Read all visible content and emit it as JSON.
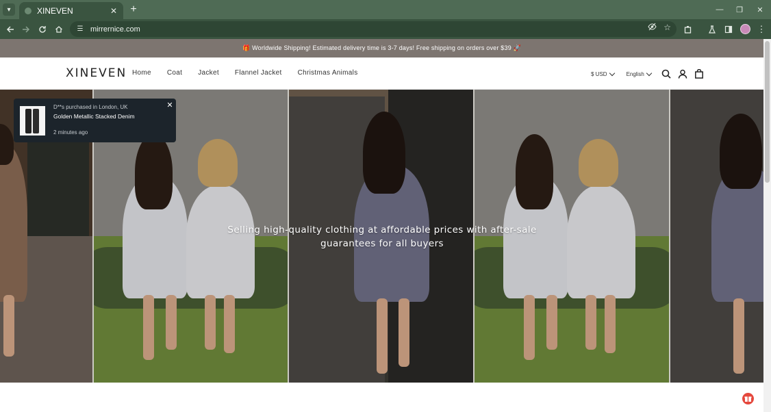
{
  "browser": {
    "tab_title": "XINEVEN",
    "tab_close": "✕",
    "new_tab": "+",
    "url": "mirrernice.com",
    "window_minimize": "—",
    "window_restore": "❐",
    "window_close": "✕"
  },
  "announcement": {
    "text": "🎁 Worldwide Shipping! Estimated delivery time is 3-7 days! Free shipping on orders over $39 🚀"
  },
  "header": {
    "logo": "XINEVEN",
    "nav": [
      "Home",
      "Coat",
      "Jacket",
      "Flannel Jacket",
      "Christmas Animals"
    ],
    "currency": "$ USD",
    "language": "English"
  },
  "hero": {
    "headline": "Selling high-quality clothing at affordable prices with after-sale guarantees for all buyers"
  },
  "toast": {
    "who": "D**s purchased in London, UK",
    "product": "Golden Metallic Stacked Denim",
    "time": "2 minutes ago",
    "close": "✕"
  },
  "colors": {
    "announcement_bg": "#7d7570",
    "toast_bg": "#1c242b",
    "chrome_bg": "#3a5440",
    "fab": "#e5483d"
  }
}
